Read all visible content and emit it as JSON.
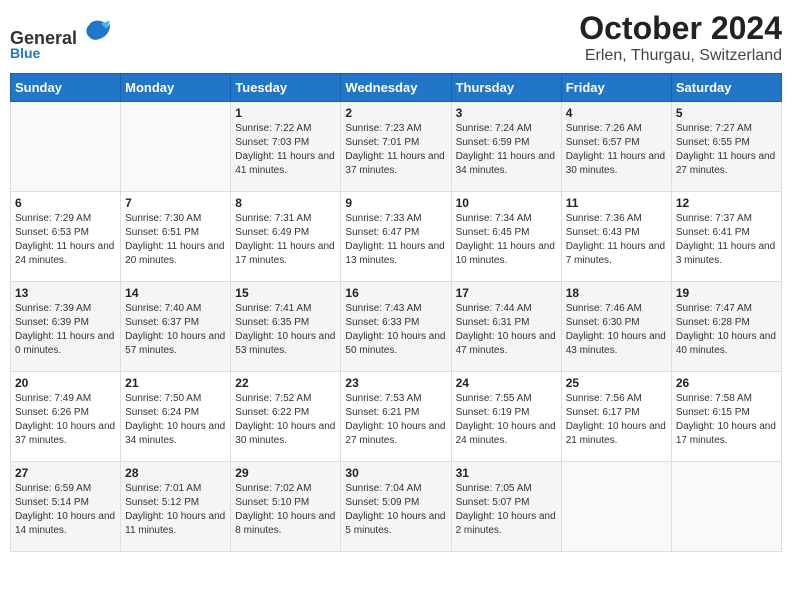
{
  "logo": {
    "general": "General",
    "blue": "Blue"
  },
  "title": "October 2024",
  "location": "Erlen, Thurgau, Switzerland",
  "headers": [
    "Sunday",
    "Monday",
    "Tuesday",
    "Wednesday",
    "Thursday",
    "Friday",
    "Saturday"
  ],
  "weeks": [
    [
      {
        "day": "",
        "sunrise": "",
        "sunset": "",
        "daylight": ""
      },
      {
        "day": "",
        "sunrise": "",
        "sunset": "",
        "daylight": ""
      },
      {
        "day": "1",
        "sunrise": "Sunrise: 7:22 AM",
        "sunset": "Sunset: 7:03 PM",
        "daylight": "Daylight: 11 hours and 41 minutes."
      },
      {
        "day": "2",
        "sunrise": "Sunrise: 7:23 AM",
        "sunset": "Sunset: 7:01 PM",
        "daylight": "Daylight: 11 hours and 37 minutes."
      },
      {
        "day": "3",
        "sunrise": "Sunrise: 7:24 AM",
        "sunset": "Sunset: 6:59 PM",
        "daylight": "Daylight: 11 hours and 34 minutes."
      },
      {
        "day": "4",
        "sunrise": "Sunrise: 7:26 AM",
        "sunset": "Sunset: 6:57 PM",
        "daylight": "Daylight: 11 hours and 30 minutes."
      },
      {
        "day": "5",
        "sunrise": "Sunrise: 7:27 AM",
        "sunset": "Sunset: 6:55 PM",
        "daylight": "Daylight: 11 hours and 27 minutes."
      }
    ],
    [
      {
        "day": "6",
        "sunrise": "Sunrise: 7:29 AM",
        "sunset": "Sunset: 6:53 PM",
        "daylight": "Daylight: 11 hours and 24 minutes."
      },
      {
        "day": "7",
        "sunrise": "Sunrise: 7:30 AM",
        "sunset": "Sunset: 6:51 PM",
        "daylight": "Daylight: 11 hours and 20 minutes."
      },
      {
        "day": "8",
        "sunrise": "Sunrise: 7:31 AM",
        "sunset": "Sunset: 6:49 PM",
        "daylight": "Daylight: 11 hours and 17 minutes."
      },
      {
        "day": "9",
        "sunrise": "Sunrise: 7:33 AM",
        "sunset": "Sunset: 6:47 PM",
        "daylight": "Daylight: 11 hours and 13 minutes."
      },
      {
        "day": "10",
        "sunrise": "Sunrise: 7:34 AM",
        "sunset": "Sunset: 6:45 PM",
        "daylight": "Daylight: 11 hours and 10 minutes."
      },
      {
        "day": "11",
        "sunrise": "Sunrise: 7:36 AM",
        "sunset": "Sunset: 6:43 PM",
        "daylight": "Daylight: 11 hours and 7 minutes."
      },
      {
        "day": "12",
        "sunrise": "Sunrise: 7:37 AM",
        "sunset": "Sunset: 6:41 PM",
        "daylight": "Daylight: 11 hours and 3 minutes."
      }
    ],
    [
      {
        "day": "13",
        "sunrise": "Sunrise: 7:39 AM",
        "sunset": "Sunset: 6:39 PM",
        "daylight": "Daylight: 11 hours and 0 minutes."
      },
      {
        "day": "14",
        "sunrise": "Sunrise: 7:40 AM",
        "sunset": "Sunset: 6:37 PM",
        "daylight": "Daylight: 10 hours and 57 minutes."
      },
      {
        "day": "15",
        "sunrise": "Sunrise: 7:41 AM",
        "sunset": "Sunset: 6:35 PM",
        "daylight": "Daylight: 10 hours and 53 minutes."
      },
      {
        "day": "16",
        "sunrise": "Sunrise: 7:43 AM",
        "sunset": "Sunset: 6:33 PM",
        "daylight": "Daylight: 10 hours and 50 minutes."
      },
      {
        "day": "17",
        "sunrise": "Sunrise: 7:44 AM",
        "sunset": "Sunset: 6:31 PM",
        "daylight": "Daylight: 10 hours and 47 minutes."
      },
      {
        "day": "18",
        "sunrise": "Sunrise: 7:46 AM",
        "sunset": "Sunset: 6:30 PM",
        "daylight": "Daylight: 10 hours and 43 minutes."
      },
      {
        "day": "19",
        "sunrise": "Sunrise: 7:47 AM",
        "sunset": "Sunset: 6:28 PM",
        "daylight": "Daylight: 10 hours and 40 minutes."
      }
    ],
    [
      {
        "day": "20",
        "sunrise": "Sunrise: 7:49 AM",
        "sunset": "Sunset: 6:26 PM",
        "daylight": "Daylight: 10 hours and 37 minutes."
      },
      {
        "day": "21",
        "sunrise": "Sunrise: 7:50 AM",
        "sunset": "Sunset: 6:24 PM",
        "daylight": "Daylight: 10 hours and 34 minutes."
      },
      {
        "day": "22",
        "sunrise": "Sunrise: 7:52 AM",
        "sunset": "Sunset: 6:22 PM",
        "daylight": "Daylight: 10 hours and 30 minutes."
      },
      {
        "day": "23",
        "sunrise": "Sunrise: 7:53 AM",
        "sunset": "Sunset: 6:21 PM",
        "daylight": "Daylight: 10 hours and 27 minutes."
      },
      {
        "day": "24",
        "sunrise": "Sunrise: 7:55 AM",
        "sunset": "Sunset: 6:19 PM",
        "daylight": "Daylight: 10 hours and 24 minutes."
      },
      {
        "day": "25",
        "sunrise": "Sunrise: 7:56 AM",
        "sunset": "Sunset: 6:17 PM",
        "daylight": "Daylight: 10 hours and 21 minutes."
      },
      {
        "day": "26",
        "sunrise": "Sunrise: 7:58 AM",
        "sunset": "Sunset: 6:15 PM",
        "daylight": "Daylight: 10 hours and 17 minutes."
      }
    ],
    [
      {
        "day": "27",
        "sunrise": "Sunrise: 6:59 AM",
        "sunset": "Sunset: 5:14 PM",
        "daylight": "Daylight: 10 hours and 14 minutes."
      },
      {
        "day": "28",
        "sunrise": "Sunrise: 7:01 AM",
        "sunset": "Sunset: 5:12 PM",
        "daylight": "Daylight: 10 hours and 11 minutes."
      },
      {
        "day": "29",
        "sunrise": "Sunrise: 7:02 AM",
        "sunset": "Sunset: 5:10 PM",
        "daylight": "Daylight: 10 hours and 8 minutes."
      },
      {
        "day": "30",
        "sunrise": "Sunrise: 7:04 AM",
        "sunset": "Sunset: 5:09 PM",
        "daylight": "Daylight: 10 hours and 5 minutes."
      },
      {
        "day": "31",
        "sunrise": "Sunrise: 7:05 AM",
        "sunset": "Sunset: 5:07 PM",
        "daylight": "Daylight: 10 hours and 2 minutes."
      },
      {
        "day": "",
        "sunrise": "",
        "sunset": "",
        "daylight": ""
      },
      {
        "day": "",
        "sunrise": "",
        "sunset": "",
        "daylight": ""
      }
    ]
  ]
}
